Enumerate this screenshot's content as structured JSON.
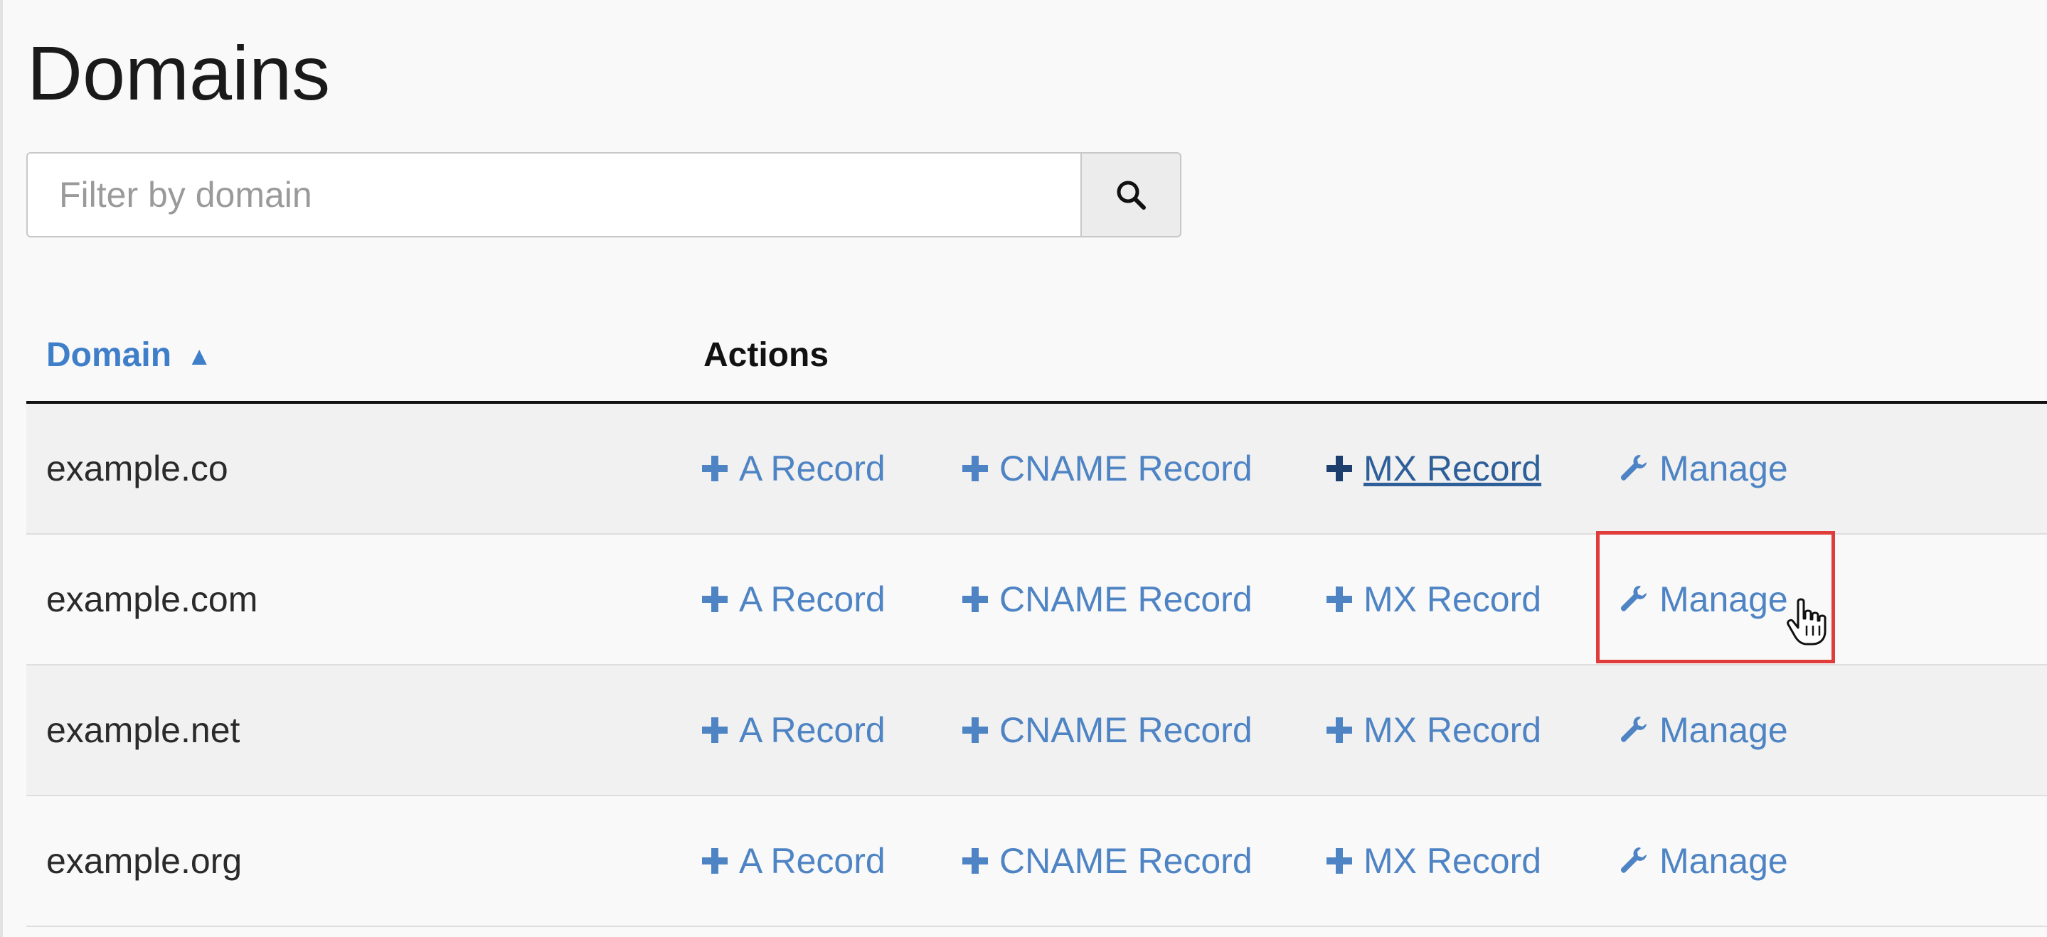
{
  "page": {
    "title": "Domains"
  },
  "search": {
    "placeholder": "Filter by domain",
    "value": "",
    "button_icon": "search-icon"
  },
  "table": {
    "columns": {
      "domain": "Domain",
      "domain_sort_indicator": "▲",
      "actions": "Actions"
    },
    "action_labels": {
      "a_record": "A Record",
      "cname_record": "CNAME Record",
      "mx_record": "MX Record",
      "manage": "Manage"
    },
    "rows": [
      {
        "domain": "example.co"
      },
      {
        "domain": "example.com"
      },
      {
        "domain": "example.net"
      },
      {
        "domain": "example.org"
      }
    ]
  },
  "state": {
    "hovered_link": "MX Record (example.co)",
    "highlighted_link": "Manage (example.com)"
  },
  "icons": {
    "add": "plus-icon",
    "manage": "wrench-icon",
    "search": "search-icon",
    "cursor": "hand-pointer-icon"
  },
  "colors": {
    "link": "#4f84c4",
    "header_link": "#3f7ec9",
    "highlight": "#e03c3c"
  }
}
